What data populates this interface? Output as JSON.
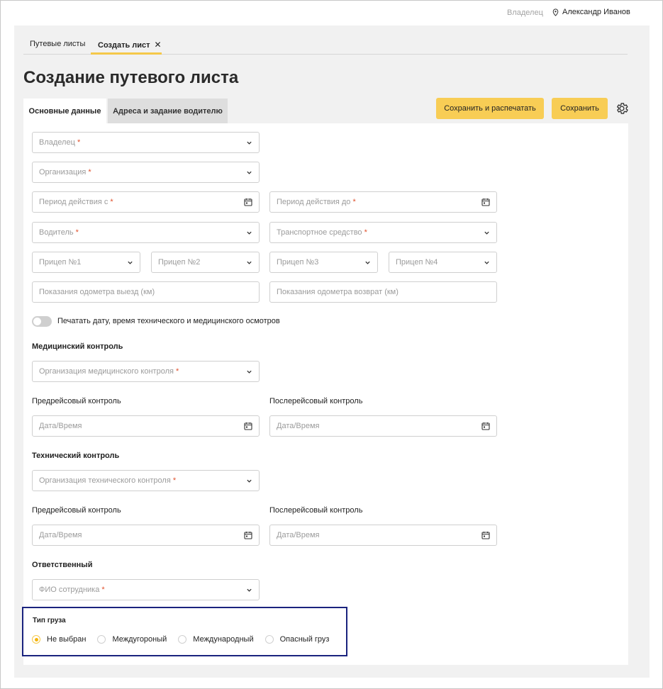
{
  "header": {
    "owner_label": "Владелец",
    "user_name": "Александр Иванов"
  },
  "top_tabs": [
    {
      "label": "Путевые листы"
    },
    {
      "label": "Создать лист",
      "close": "✕"
    }
  ],
  "page_title": "Создание путевого листа",
  "content_tabs": [
    {
      "label": "Основные данные"
    },
    {
      "label": "Адреса и задание водителю"
    }
  ],
  "actions": {
    "save_print": "Сохранить и распечатать",
    "save": "Сохранить"
  },
  "fields": {
    "owner": "Владелец",
    "organization": "Организация",
    "period_from": "Период действия с",
    "period_to": "Период действия до",
    "driver": "Водитель",
    "vehicle": "Транспортное средство",
    "trailer1": "Прицеп №1",
    "trailer2": "Прицеп №2",
    "trailer3": "Прицеп №3",
    "trailer4": "Прицеп №4",
    "odometer_out": "Показания одометра выезд (км)",
    "odometer_return": "Показания одометра возврат (км)",
    "required_mark": "*"
  },
  "print_toggle": {
    "label": "Печатать дату, время технического и медицинского осмотров"
  },
  "medical": {
    "title": "Медицинский контроль",
    "org": "Организация медицинского контроля",
    "pre_label": "Предрейсовый контроль",
    "post_label": "Послерейсовый контроль",
    "datetime": "Дата/Время"
  },
  "technical": {
    "title": "Технический контроль",
    "org": "Организация технического контроля",
    "pre_label": "Предрейсовый контроль",
    "post_label": "Послерейсовый контроль",
    "datetime": "Дата/Время"
  },
  "responsible": {
    "title": "Ответственный",
    "employee": "ФИО сотрудника"
  },
  "cargo": {
    "title": "Тип груза",
    "options": [
      "Не выбран",
      "Междугороный",
      "Международный",
      "Опасный груз"
    ],
    "selected": "Не выбран"
  },
  "colors": {
    "accent": "#f8cd55",
    "highlight_border": "#1a237e",
    "required": "#e0502c"
  }
}
